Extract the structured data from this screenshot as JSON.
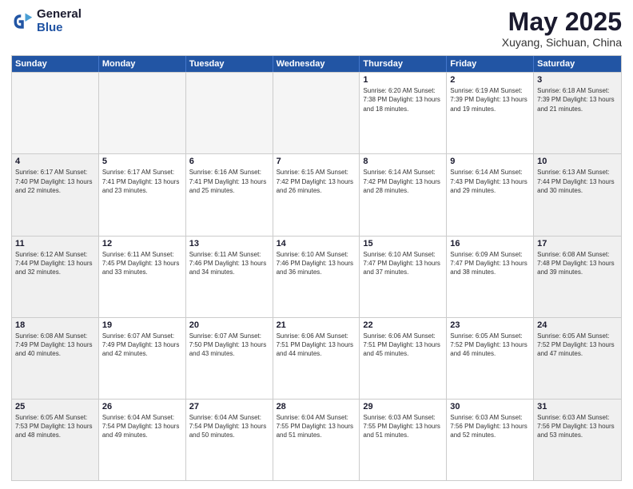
{
  "logo": {
    "general": "General",
    "blue": "Blue"
  },
  "header": {
    "title": "May 2025",
    "subtitle": "Xuyang, Sichuan, China"
  },
  "weekdays": [
    "Sunday",
    "Monday",
    "Tuesday",
    "Wednesday",
    "Thursday",
    "Friday",
    "Saturday"
  ],
  "weeks": [
    [
      {
        "day": "",
        "empty": true,
        "info": ""
      },
      {
        "day": "",
        "empty": true,
        "info": ""
      },
      {
        "day": "",
        "empty": true,
        "info": ""
      },
      {
        "day": "",
        "empty": true,
        "info": ""
      },
      {
        "day": "1",
        "empty": false,
        "info": "Sunrise: 6:20 AM\nSunset: 7:38 PM\nDaylight: 13 hours\nand 18 minutes."
      },
      {
        "day": "2",
        "empty": false,
        "info": "Sunrise: 6:19 AM\nSunset: 7:39 PM\nDaylight: 13 hours\nand 19 minutes."
      },
      {
        "day": "3",
        "empty": false,
        "shaded": true,
        "info": "Sunrise: 6:18 AM\nSunset: 7:39 PM\nDaylight: 13 hours\nand 21 minutes."
      }
    ],
    [
      {
        "day": "4",
        "empty": false,
        "shaded": true,
        "info": "Sunrise: 6:17 AM\nSunset: 7:40 PM\nDaylight: 13 hours\nand 22 minutes."
      },
      {
        "day": "5",
        "empty": false,
        "info": "Sunrise: 6:17 AM\nSunset: 7:41 PM\nDaylight: 13 hours\nand 23 minutes."
      },
      {
        "day": "6",
        "empty": false,
        "info": "Sunrise: 6:16 AM\nSunset: 7:41 PM\nDaylight: 13 hours\nand 25 minutes."
      },
      {
        "day": "7",
        "empty": false,
        "info": "Sunrise: 6:15 AM\nSunset: 7:42 PM\nDaylight: 13 hours\nand 26 minutes."
      },
      {
        "day": "8",
        "empty": false,
        "info": "Sunrise: 6:14 AM\nSunset: 7:42 PM\nDaylight: 13 hours\nand 28 minutes."
      },
      {
        "day": "9",
        "empty": false,
        "info": "Sunrise: 6:14 AM\nSunset: 7:43 PM\nDaylight: 13 hours\nand 29 minutes."
      },
      {
        "day": "10",
        "empty": false,
        "shaded": true,
        "info": "Sunrise: 6:13 AM\nSunset: 7:44 PM\nDaylight: 13 hours\nand 30 minutes."
      }
    ],
    [
      {
        "day": "11",
        "empty": false,
        "shaded": true,
        "info": "Sunrise: 6:12 AM\nSunset: 7:44 PM\nDaylight: 13 hours\nand 32 minutes."
      },
      {
        "day": "12",
        "empty": false,
        "info": "Sunrise: 6:11 AM\nSunset: 7:45 PM\nDaylight: 13 hours\nand 33 minutes."
      },
      {
        "day": "13",
        "empty": false,
        "info": "Sunrise: 6:11 AM\nSunset: 7:46 PM\nDaylight: 13 hours\nand 34 minutes."
      },
      {
        "day": "14",
        "empty": false,
        "info": "Sunrise: 6:10 AM\nSunset: 7:46 PM\nDaylight: 13 hours\nand 36 minutes."
      },
      {
        "day": "15",
        "empty": false,
        "info": "Sunrise: 6:10 AM\nSunset: 7:47 PM\nDaylight: 13 hours\nand 37 minutes."
      },
      {
        "day": "16",
        "empty": false,
        "info": "Sunrise: 6:09 AM\nSunset: 7:47 PM\nDaylight: 13 hours\nand 38 minutes."
      },
      {
        "day": "17",
        "empty": false,
        "shaded": true,
        "info": "Sunrise: 6:08 AM\nSunset: 7:48 PM\nDaylight: 13 hours\nand 39 minutes."
      }
    ],
    [
      {
        "day": "18",
        "empty": false,
        "shaded": true,
        "info": "Sunrise: 6:08 AM\nSunset: 7:49 PM\nDaylight: 13 hours\nand 40 minutes."
      },
      {
        "day": "19",
        "empty": false,
        "info": "Sunrise: 6:07 AM\nSunset: 7:49 PM\nDaylight: 13 hours\nand 42 minutes."
      },
      {
        "day": "20",
        "empty": false,
        "info": "Sunrise: 6:07 AM\nSunset: 7:50 PM\nDaylight: 13 hours\nand 43 minutes."
      },
      {
        "day": "21",
        "empty": false,
        "info": "Sunrise: 6:06 AM\nSunset: 7:51 PM\nDaylight: 13 hours\nand 44 minutes."
      },
      {
        "day": "22",
        "empty": false,
        "info": "Sunrise: 6:06 AM\nSunset: 7:51 PM\nDaylight: 13 hours\nand 45 minutes."
      },
      {
        "day": "23",
        "empty": false,
        "info": "Sunrise: 6:05 AM\nSunset: 7:52 PM\nDaylight: 13 hours\nand 46 minutes."
      },
      {
        "day": "24",
        "empty": false,
        "shaded": true,
        "info": "Sunrise: 6:05 AM\nSunset: 7:52 PM\nDaylight: 13 hours\nand 47 minutes."
      }
    ],
    [
      {
        "day": "25",
        "empty": false,
        "shaded": true,
        "info": "Sunrise: 6:05 AM\nSunset: 7:53 PM\nDaylight: 13 hours\nand 48 minutes."
      },
      {
        "day": "26",
        "empty": false,
        "info": "Sunrise: 6:04 AM\nSunset: 7:54 PM\nDaylight: 13 hours\nand 49 minutes."
      },
      {
        "day": "27",
        "empty": false,
        "info": "Sunrise: 6:04 AM\nSunset: 7:54 PM\nDaylight: 13 hours\nand 50 minutes."
      },
      {
        "day": "28",
        "empty": false,
        "info": "Sunrise: 6:04 AM\nSunset: 7:55 PM\nDaylight: 13 hours\nand 51 minutes."
      },
      {
        "day": "29",
        "empty": false,
        "info": "Sunrise: 6:03 AM\nSunset: 7:55 PM\nDaylight: 13 hours\nand 51 minutes."
      },
      {
        "day": "30",
        "empty": false,
        "info": "Sunrise: 6:03 AM\nSunset: 7:56 PM\nDaylight: 13 hours\nand 52 minutes."
      },
      {
        "day": "31",
        "empty": false,
        "shaded": true,
        "info": "Sunrise: 6:03 AM\nSunset: 7:56 PM\nDaylight: 13 hours\nand 53 minutes."
      }
    ]
  ]
}
